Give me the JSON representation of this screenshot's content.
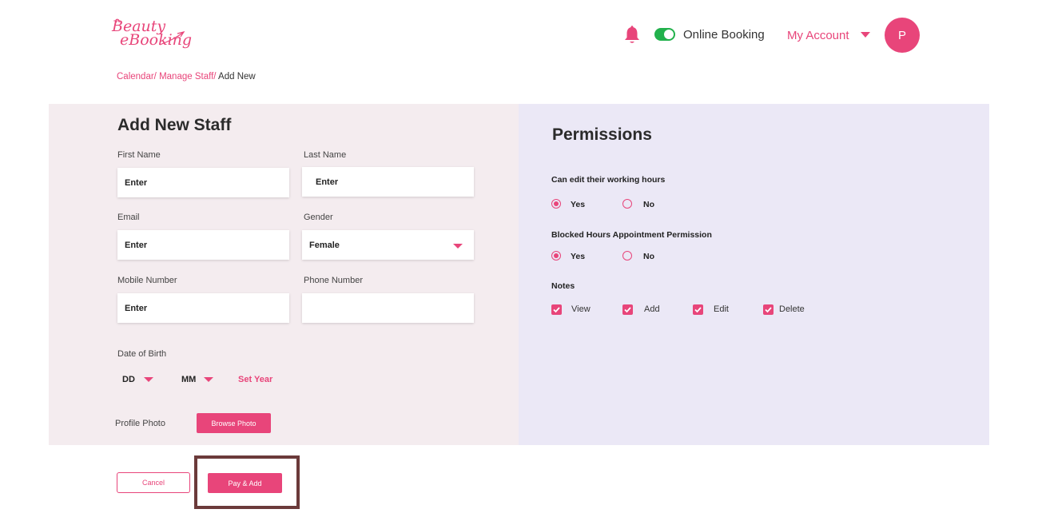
{
  "header": {
    "logo_line1": "Beauty",
    "logo_line2": "eBooking",
    "online_booking_label": "Online Booking",
    "my_account_label": "My Account",
    "avatar_initial": "P",
    "online_booking_on": true
  },
  "breadcrumb": {
    "items": [
      "Calendar/",
      "Manage Staff/",
      "Add New"
    ]
  },
  "form": {
    "title": "Add New Staff",
    "first_name_label": "First Name",
    "first_name_value": "Enter",
    "last_name_label": "Last Name",
    "last_name_value": "Enter",
    "email_label": "Email",
    "email_value": "Enter",
    "gender_label": "Gender",
    "gender_value": "Female",
    "mobile_label": "Mobile Number",
    "mobile_value": "Enter",
    "phone_label": "Phone Number",
    "phone_value": "",
    "dob_label": "Date of Birth",
    "dob_day": "DD",
    "dob_month": "MM",
    "dob_set_year": "Set Year",
    "profile_photo_label": "Profile Photo",
    "browse_photo_label": "Browse Photo"
  },
  "permissions": {
    "title": "Permissions",
    "working_hours_label": "Can edit their working hours",
    "working_hours_yes": "Yes",
    "working_hours_no": "No",
    "working_hours_selected": "Yes",
    "blocked_hours_label": "Blocked Hours Appointment Permission",
    "blocked_hours_yes": "Yes",
    "blocked_hours_no": "No",
    "blocked_hours_selected": "Yes",
    "notes_label": "Notes",
    "notes_options": [
      {
        "label": "View",
        "checked": true
      },
      {
        "label": "Add",
        "checked": true
      },
      {
        "label": "Edit",
        "checked": true
      },
      {
        "label": "Delete",
        "checked": true
      }
    ]
  },
  "actions": {
    "cancel_label": "Cancel",
    "pay_add_label": "Pay & Add"
  },
  "colors": {
    "brand": "#e8457a",
    "toggle_on": "#22b14c",
    "left_panel_bg": "#f4ecef",
    "right_panel_bg": "#ebe8f6"
  },
  "icons": {
    "bell": "bell-icon",
    "dropdown": "chevron-down-icon",
    "check": "check-icon"
  }
}
